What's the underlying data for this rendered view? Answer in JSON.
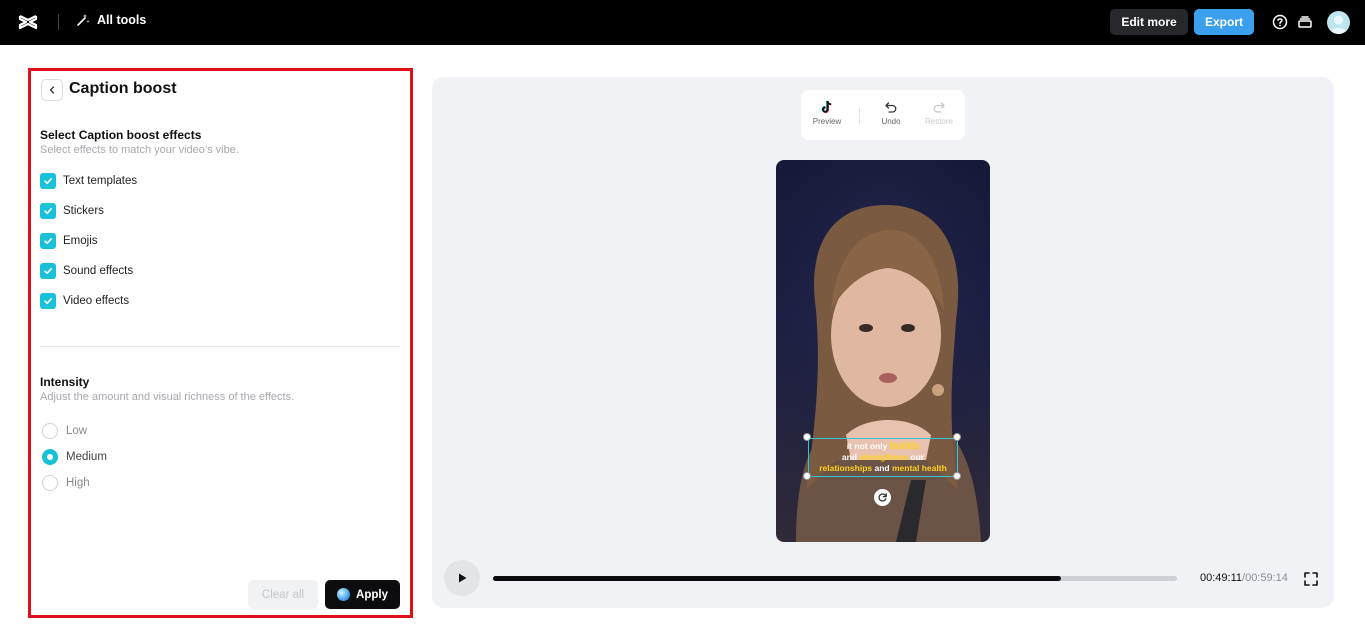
{
  "topbar": {
    "all_tools_label": "All tools",
    "edit_more_label": "Edit more",
    "export_label": "Export",
    "accent": "#3a9fec"
  },
  "panel": {
    "title": "Caption boost",
    "effects_title": "Select Caption boost effects",
    "effects_subtitle": "Select effects to match your video’s vibe.",
    "effects": [
      {
        "label": "Text templates",
        "checked": true
      },
      {
        "label": "Stickers",
        "checked": true
      },
      {
        "label": "Emojis",
        "checked": true
      },
      {
        "label": "Sound effects",
        "checked": true
      },
      {
        "label": "Video effects",
        "checked": true
      }
    ],
    "intensity_title": "Intensity",
    "intensity_subtitle": "Adjust the amount and visual richness of the effects.",
    "intensity_options": [
      {
        "label": "Low",
        "selected": false
      },
      {
        "label": "Medium",
        "selected": true
      },
      {
        "label": "High",
        "selected": false
      }
    ],
    "clear_all_label": "Clear all",
    "apply_label": "Apply",
    "check_color": "#19c1d8"
  },
  "preview": {
    "toolbar": {
      "preview_label": "Preview",
      "undo_label": "Undo",
      "restore_label": "Restore"
    },
    "caption": {
      "line1": {
        "pre": "it not only ",
        "hl": "builds"
      },
      "line2": {
        "pre": "and ",
        "hl": "strengthens",
        "post": " our"
      },
      "line3": {
        "hl1": "relationships",
        "mid": " and ",
        "hl2": "mental health"
      },
      "highlight_color": "#ffd21a"
    },
    "player": {
      "current_time": "00:49:11",
      "total_time": "/00:59:14",
      "progress": 0.83
    }
  }
}
